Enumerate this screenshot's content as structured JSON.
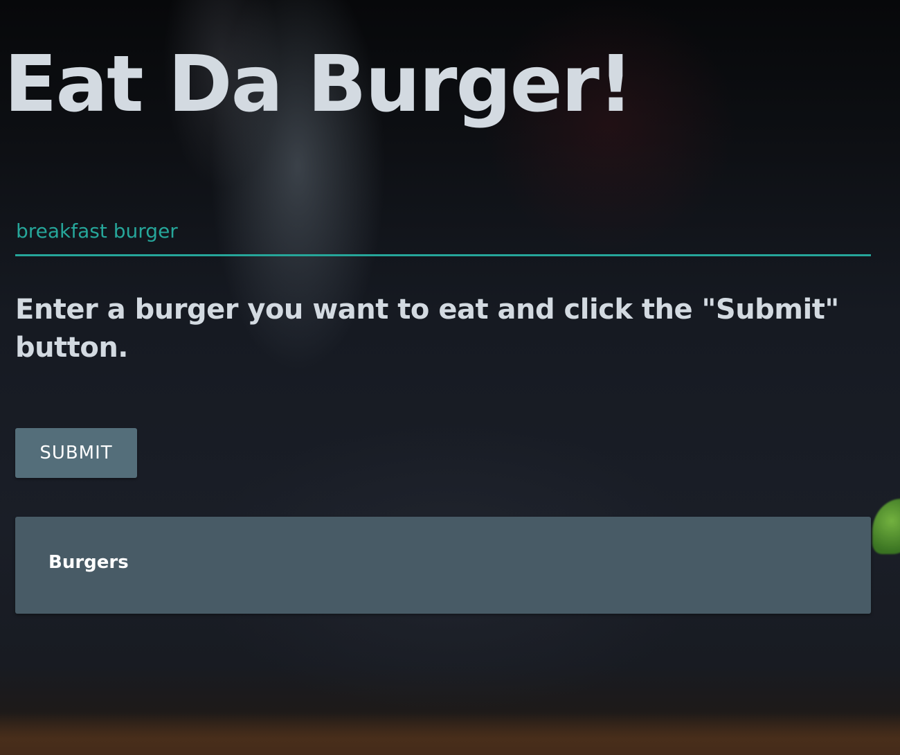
{
  "header": {
    "title": "Eat Da Burger!"
  },
  "form": {
    "burger_input_value": "breakfast burger",
    "instructions": "Enter a burger you want to eat and click the \"Submit\" button.",
    "submit_label": "SUBMIT"
  },
  "burgers_panel": {
    "heading": "Burgers"
  },
  "colors": {
    "accent": "#26a69a",
    "button": "#546e7a",
    "panel": "#485b66",
    "text": "#d3dae1"
  }
}
